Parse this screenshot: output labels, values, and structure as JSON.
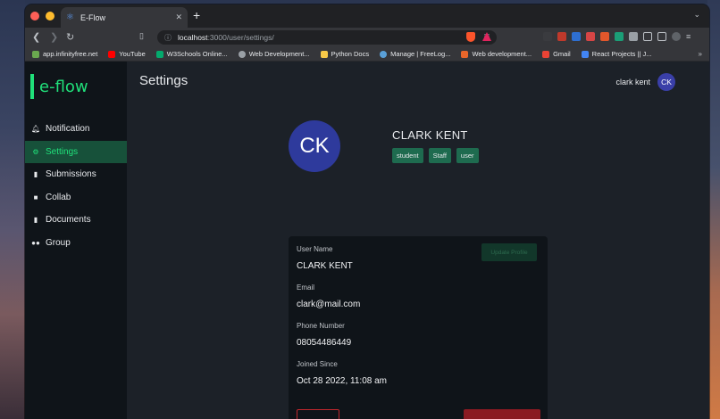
{
  "browser": {
    "tab_title": "E-Flow",
    "url_host": "localhost",
    "url_path": ":3000/user/settings/",
    "bookmarks": [
      "app.infinityfree.net",
      "YouTube",
      "W3Schools Online...",
      "Web Development...",
      "Python Docs",
      "Manage | FreeLog...",
      "Web development...",
      "Gmail",
      "React Projects || J..."
    ],
    "icons": {
      "back": "back-arrow-icon",
      "forward": "forward-arrow-icon",
      "reload": "reload-icon",
      "bookmark": "bookmark-icon",
      "site_info": "info-icon",
      "key": "key-icon",
      "extensions": "puzzle-icon",
      "menu": "more-icon"
    }
  },
  "app": {
    "brand": "e-flow",
    "page_title": "Settings",
    "current_user": {
      "name": "clark kent",
      "initials": "CK"
    },
    "menu": [
      {
        "label": "Notification",
        "icon": "bell-icon",
        "active": false
      },
      {
        "label": "Settings",
        "icon": "gear-icon",
        "active": true
      },
      {
        "label": "Submissions",
        "icon": "document-icon",
        "active": false
      },
      {
        "label": "Collab",
        "icon": "video-icon",
        "active": false
      },
      {
        "label": "Documents",
        "icon": "document-icon",
        "active": false
      },
      {
        "label": "Group",
        "icon": "group-icon",
        "active": false
      }
    ],
    "profile": {
      "initials": "CK",
      "name": "CLARK KENT",
      "roles": [
        "student",
        "Staff",
        "user"
      ]
    },
    "card": {
      "update_label": "Update Profile",
      "fields": [
        {
          "label": "User Name",
          "value": "CLARK KENT"
        },
        {
          "label": "Email",
          "value": "clark@mail.com"
        },
        {
          "label": "Phone Number",
          "value": "08054486449"
        },
        {
          "label": "Joined Since",
          "value": "Oct 28 2022, 11:08 am"
        }
      ]
    },
    "colors": {
      "accent": "#20e07a",
      "sidebar_bg": "#0f1419",
      "main_bg": "#1c2128",
      "avatar": "#2e3a9c"
    }
  }
}
